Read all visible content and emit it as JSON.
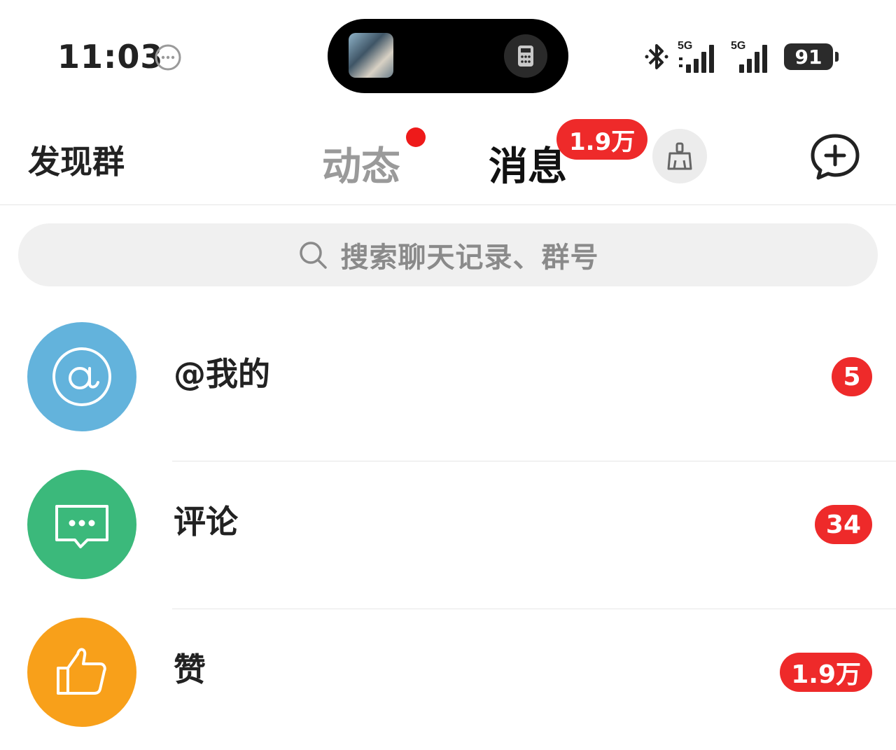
{
  "status_bar": {
    "time": "11:03",
    "network_1": "5G",
    "network_2": "5G",
    "battery": "91"
  },
  "header": {
    "discover_label": "发现群",
    "tabs": [
      {
        "label": "动态",
        "has_dot": true
      },
      {
        "label": "消息",
        "badge": "1.9万",
        "active": true
      }
    ]
  },
  "search": {
    "placeholder": "搜索聊天记录、群号"
  },
  "items": [
    {
      "label": "@我的",
      "count": "5",
      "icon": "at-icon",
      "color": "#63b3dc"
    },
    {
      "label": "评论",
      "count": "34",
      "icon": "comment-icon",
      "color": "#3bb97b"
    },
    {
      "label": "赞",
      "count": "1.9万",
      "icon": "thumbs-up-icon",
      "color": "#f8a01a"
    }
  ],
  "colors": {
    "badge": "#ee2a2a",
    "accent": "#f7b21a"
  }
}
